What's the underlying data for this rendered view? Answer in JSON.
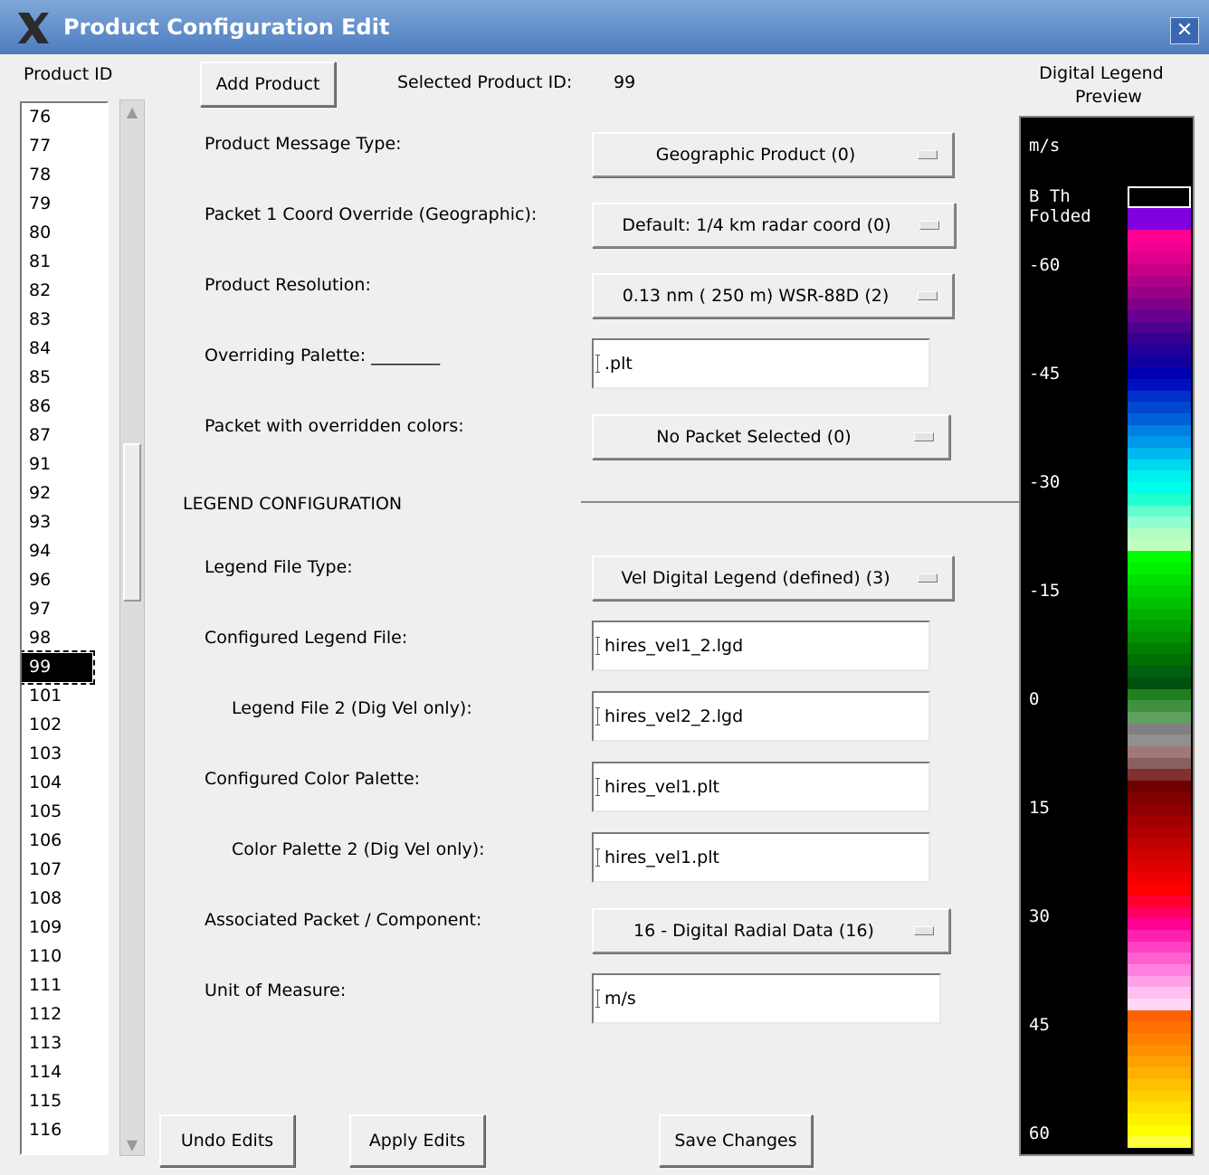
{
  "window": {
    "title": "Product Configuration Edit",
    "close_glyph": "✕"
  },
  "product_list": {
    "header": "Product ID",
    "items": [
      "76",
      "77",
      "78",
      "79",
      "80",
      "81",
      "82",
      "83",
      "84",
      "85",
      "86",
      "87",
      "91",
      "92",
      "93",
      "94",
      "96",
      "97",
      "98",
      "99",
      "101",
      "102",
      "103",
      "104",
      "105",
      "106",
      "107",
      "108",
      "109",
      "110",
      "111",
      "112",
      "113",
      "114",
      "115",
      "116"
    ],
    "selected": "99"
  },
  "toolbar": {
    "add_product": "Add Product",
    "selected_label": "Selected Product ID:",
    "selected_value": "99"
  },
  "fields": {
    "message_type": {
      "label": "Product Message Type:",
      "value": "Geographic Product (0)"
    },
    "packet1_coord": {
      "label": "Packet 1 Coord Override (Geographic):",
      "value": "Default: 1/4 km radar coord (0)"
    },
    "resolution": {
      "label": "Product Resolution:",
      "value": "0.13 nm ( 250 m) WSR-88D (2)"
    },
    "overriding_palette": {
      "label": "Overriding Palette: ________",
      "value": ".plt"
    },
    "packet_override": {
      "label": "Packet with overridden colors:",
      "value": "No Packet Selected (0)"
    },
    "legend_section": "LEGEND CONFIGURATION",
    "legend_file_type": {
      "label": "Legend File Type:",
      "value": "Vel Digital Legend (defined) (3)"
    },
    "configured_legend": {
      "label": "Configured Legend File:",
      "value": "hires_vel1_2.lgd"
    },
    "legend_file2": {
      "label": "Legend File 2 (Dig Vel only):",
      "value": "hires_vel2_2.lgd"
    },
    "configured_palette": {
      "label": "Configured Color Palette:",
      "value": "hires_vel1.plt"
    },
    "palette2": {
      "label": "Color Palette 2 (Dig Vel only):",
      "value": "hires_vel1.plt"
    },
    "assoc_packet": {
      "label": "Associated Packet / Component:",
      "value": "16 - Digital Radial Data (16)"
    },
    "unit": {
      "label": "Unit of Measure:",
      "value": "m/s"
    }
  },
  "buttons": {
    "undo": "Undo Edits",
    "apply": "Apply Edits",
    "save": "Save Changes"
  },
  "legend_preview": {
    "header_line1": "Digital Legend",
    "header_line2": "Preview",
    "unit": "m/s",
    "bth_line1": "B Th",
    "bth_line2": "Folded",
    "ticks": [
      "-60",
      "-45",
      "-30",
      "-15",
      "0",
      "15",
      "30",
      "45",
      "60"
    ],
    "colors": [
      "#ff0090",
      "#f20090",
      "#e0008c",
      "#c80088",
      "#b00088",
      "#980088",
      "#800088",
      "#680090",
      "#500090",
      "#380090",
      "#200098",
      "#1000a0",
      "#0000b0",
      "#0010c0",
      "#0030c8",
      "#0048d0",
      "#0060d8",
      "#0080e0",
      "#0098e8",
      "#00b8f0",
      "#00d8f0",
      "#00f0f0",
      "#00ffe8",
      "#20ffd0",
      "#60ffd0",
      "#90ffd0",
      "#b0ffc0",
      "#c0ffc0",
      "#00ff00",
      "#00f000",
      "#00e000",
      "#00d000",
      "#00c000",
      "#00b000",
      "#00a000",
      "#009000",
      "#008000",
      "#007000",
      "#006010",
      "#005010",
      "#208020",
      "#409040",
      "#60a060",
      "#808080",
      "#909090",
      "#a07878",
      "#886060",
      "#803030",
      "#700000",
      "#800000",
      "#900000",
      "#a00000",
      "#b00000",
      "#c00000",
      "#d00000",
      "#e00000",
      "#f00000",
      "#ff0000",
      "#ff0030",
      "#ff0060",
      "#ff0090",
      "#ff20b0",
      "#ff40c0",
      "#ff60d0",
      "#ff80e0",
      "#ffa0e8",
      "#ffc0f0",
      "#ffd8f8",
      "#ff6000",
      "#ff7000",
      "#ff8000",
      "#ff9000",
      "#ffa000",
      "#ffb000",
      "#ffc000",
      "#ffd000",
      "#ffe000",
      "#fff000",
      "#ffff00",
      "#ffff40"
    ]
  }
}
